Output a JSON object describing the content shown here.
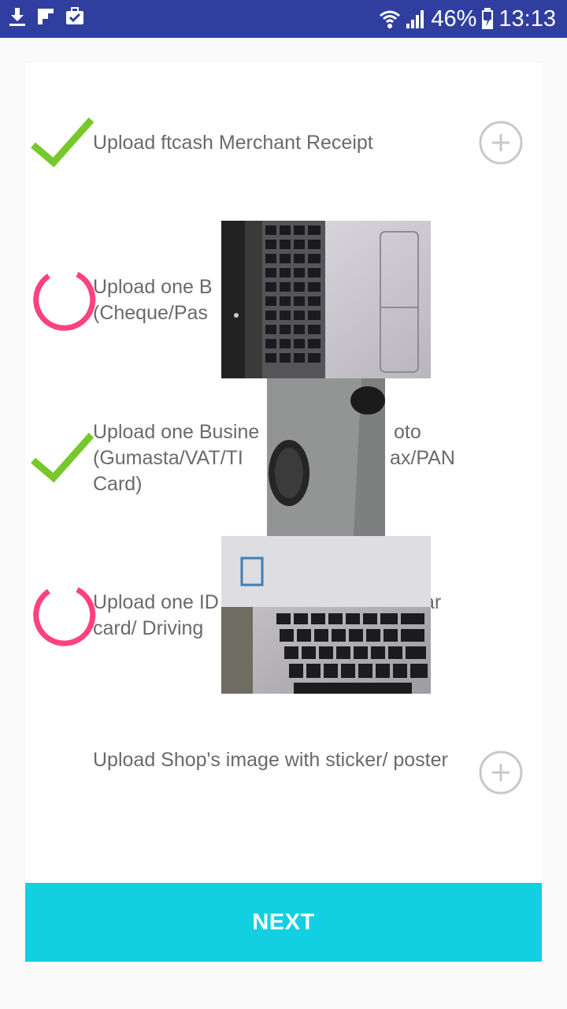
{
  "status_bar": {
    "icons_left": [
      "download-icon",
      "flipboard-icon",
      "briefcase-check-icon"
    ],
    "wifi_icon": "wifi-icon",
    "signal_icon": "signal-icon",
    "battery_percent": "46%",
    "battery_icon": "battery-charging-icon",
    "time": "13:13"
  },
  "items": [
    {
      "label": "Upload ftcash Merchant Receipt",
      "status": "done"
    },
    {
      "label": "Upload one Bank Proof Photo (Cheque/Passbook)",
      "visible_label_line1": "Upload one B",
      "visible_label_line2": "(Cheque/Pas",
      "status": "uploading"
    },
    {
      "label_line1": "Upload one Busine",
      "label_line1_tail": "oto",
      "label_line2": "(Gumasta/VAT/TI",
      "label_line2_tail": "ax/PAN",
      "label_line3": "Card)",
      "status": "done"
    },
    {
      "label_line1": "Upload one ID",
      "label_line1_tail": "ar",
      "label_line2": "card/ Driving",
      "status": "uploading"
    },
    {
      "label": "Upload Shop's image with sticker/ poster",
      "status": "pending"
    }
  ],
  "next_button": {
    "label": "NEXT"
  },
  "colors": {
    "status_bar": "#303f9f",
    "check": "#76c82d",
    "spinner": "#ff4081",
    "button": "#12cfe2",
    "text": "#6a6a6a"
  }
}
